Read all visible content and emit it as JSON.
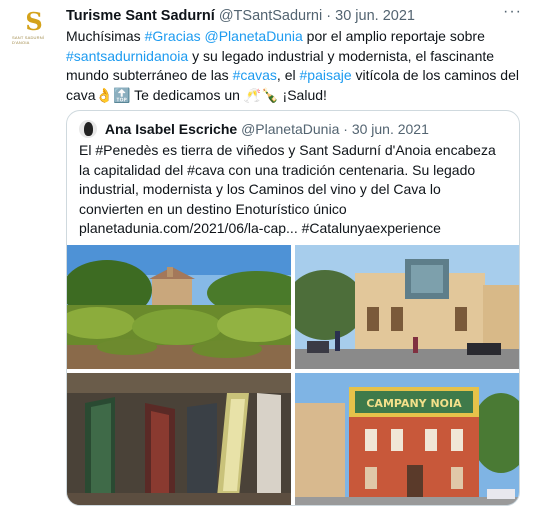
{
  "tweet": {
    "author_name": "Turisme Sant Sadurní",
    "handle": "@TSantSadurni",
    "separator": "·",
    "date": "30 jun. 2021",
    "more_label": "···",
    "avatar_letter": "S",
    "avatar_text": "SANT SADURNÍ D'ANOIA",
    "body": {
      "t1": "Muchísimas ",
      "h_gracias": "#Gracias",
      "t2": " ",
      "m_planeta": "@PlanetaDunia",
      "t3": " por el amplio reportaje sobre ",
      "h_santsadurni": "#santsadurnidanoia",
      "t4": " y su legado industrial y modernista, el fascinante mundo subterráneo de las ",
      "h_cavas": "#cavas",
      "t5": ", el ",
      "h_paisaje": "#paisaje",
      "t6": " vitícola de los caminos del cava👌🔝 Te dedicamos un 🥂🍾 ¡Salud!"
    }
  },
  "quoted": {
    "author_name": "Ana Isabel Escriche",
    "handle": "@PlanetaDunia",
    "separator": "·",
    "date": "30 jun. 2021",
    "body": "El #Penedès es tierra de viñedos y Sant Sadurní d'Anoia encabeza la capitalidad del #cava con una tradición centenaria. Su legado industrial, modernista y los Caminos del vino y del Cava lo convierten en un destino Enoturístico único  planetadunia.com/2021/06/la-cap... #Catalunyaexperience",
    "photo_sign_text": "CAMPANY NOIA"
  },
  "colors": {
    "link": "#1d9bf0",
    "text": "#0f1419",
    "muted": "#536471",
    "border": "#cfd9de",
    "avatar_gold": "#d4a21a"
  }
}
